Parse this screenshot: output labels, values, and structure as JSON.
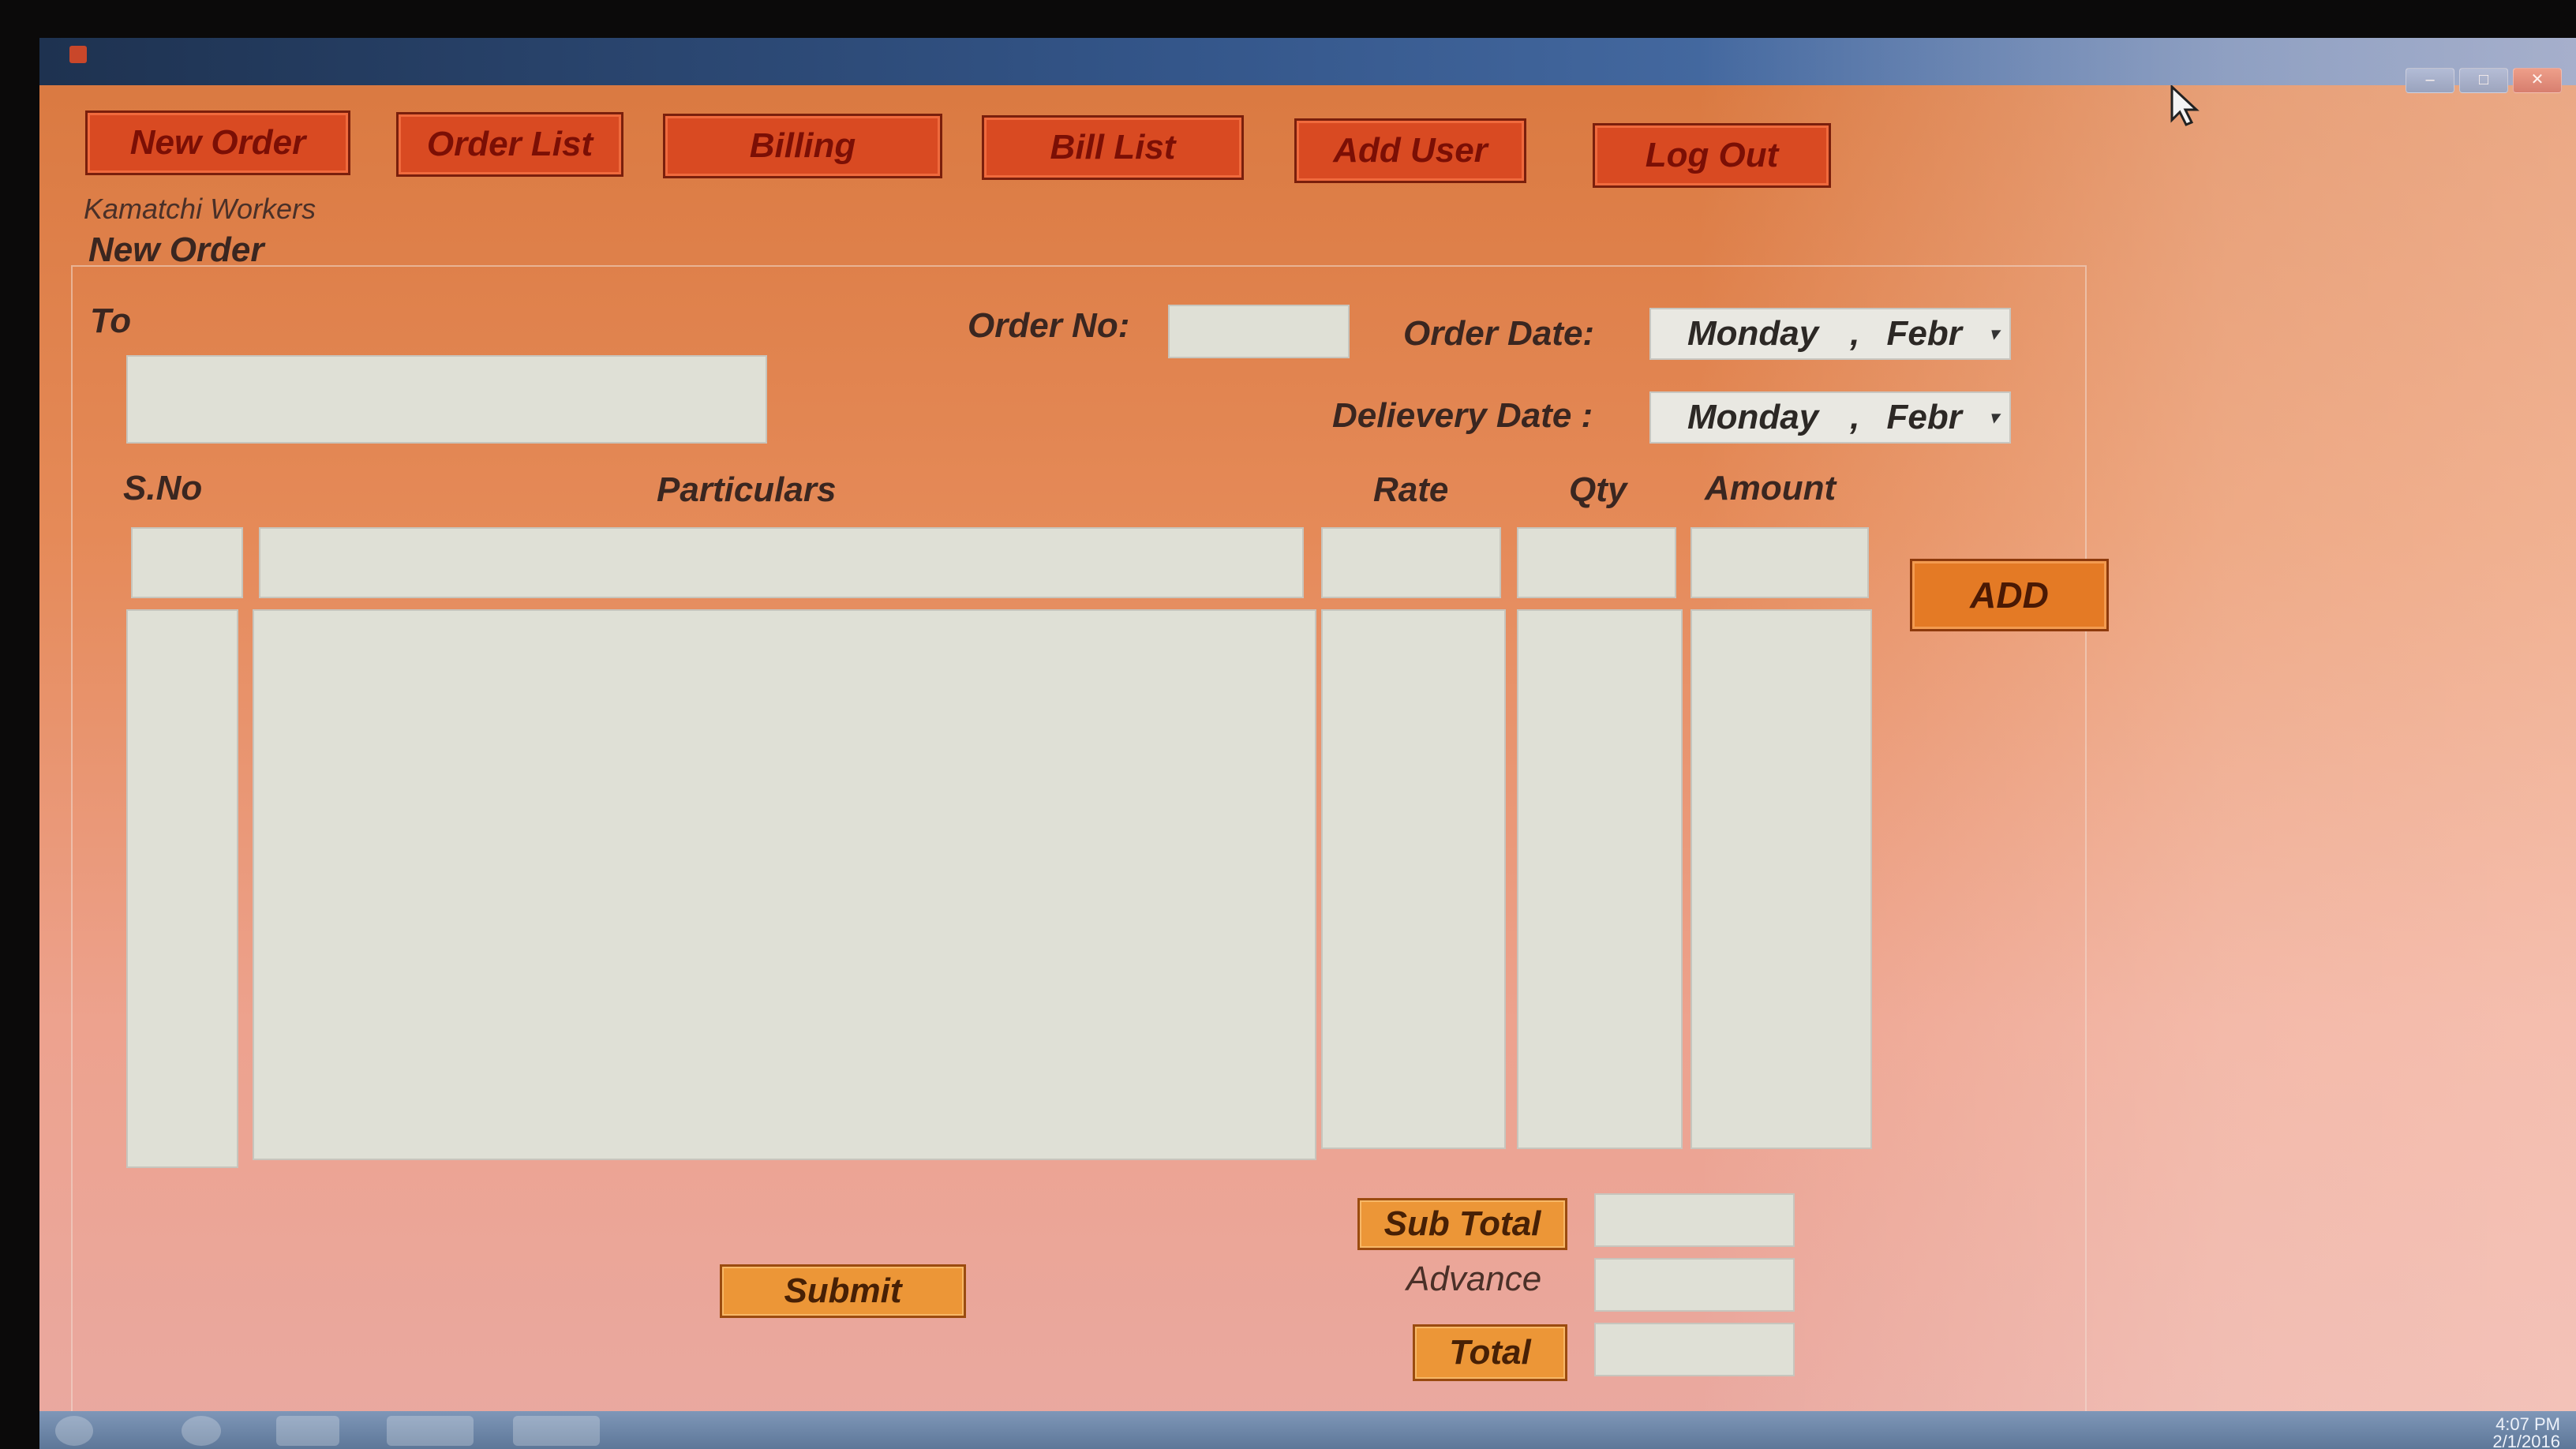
{
  "nav": {
    "new_order": "New Order",
    "order_list": "Order List",
    "billing": "Billing",
    "bill_list": "Bill List",
    "add_user": "Add User",
    "log_out": "Log Out"
  },
  "company": "Kamatchi Workers",
  "section_title": "New Order",
  "form": {
    "to_label": "To",
    "order_no_label": "Order No:",
    "order_date_label": "Order Date:",
    "order_date_day": "Monday",
    "order_date_sep": ",",
    "order_date_month": "Febr",
    "delivery_date_label": "Delievery Date :",
    "delivery_date_day": "Monday",
    "delivery_date_sep": ",",
    "delivery_date_month": "Febr"
  },
  "columns": {
    "sno": "S.No",
    "particulars": "Particulars",
    "rate": "Rate",
    "qty": "Qty",
    "amount": "Amount"
  },
  "buttons": {
    "add": "ADD",
    "submit": "Submit",
    "sub_total": "Sub Total",
    "total": "Total"
  },
  "advance_label": "Advance",
  "tray": {
    "time": "4:07 PM",
    "date": "2/1/2016"
  },
  "colors": {
    "nav_button": "#d94a22",
    "action_button": "#ec9637",
    "add_button": "#e47a25",
    "field": "#dfe0d6"
  }
}
